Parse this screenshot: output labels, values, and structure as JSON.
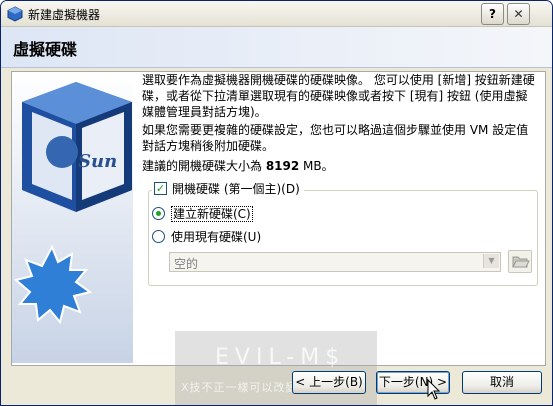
{
  "window": {
    "title": "新建虛擬機器",
    "help_label": "?",
    "close_label": "✕"
  },
  "page": {
    "title": "虛擬硬碟"
  },
  "intro": {
    "paragraph1": "選取要作為虛擬機器開機硬碟的硬碟映像。 您可以使用 [新增] 按鈕新建硬碟，或者從下拉清單選取現有的硬碟映像或者按下 [現有] 按鈕 (使用虛擬媒體管理員對話方塊)。",
    "paragraph2": "如果您需要更複雜的硬碟設定，您也可以略過這個步驟並使用 VM 設定值對話方塊稍後附加硬碟。",
    "recommend_prefix": "建議的開機硬碟大小為 ",
    "recommend_size": "8192",
    "recommend_unit": " MB。"
  },
  "boot_disk": {
    "label": "開機硬碟 (第一個主)(D)",
    "checked": true,
    "check_glyph": "✓"
  },
  "options": {
    "create_new": {
      "label": "建立新硬碟(C)",
      "selected": true
    },
    "use_existing": {
      "label": "使用現有硬碟(U)",
      "selected": false
    }
  },
  "existing_select": {
    "value": "空的",
    "arrow": "▼",
    "disabled": true
  },
  "buttons": {
    "back": "< 上一步(B)",
    "next": "下一步(N) >",
    "cancel": "取消"
  },
  "watermark": {
    "text": "EVIL-M$",
    "subtext": "X技不正一樣可以改變世界"
  },
  "brand": {
    "logo_text": "Sun",
    "accent": "#21a121",
    "border": "#003c74"
  },
  "icons": [
    "virtualbox-logo-icon",
    "help-icon",
    "close-icon",
    "folder-open-icon",
    "mouse-cursor-icon",
    "sun-logo-icon"
  ]
}
